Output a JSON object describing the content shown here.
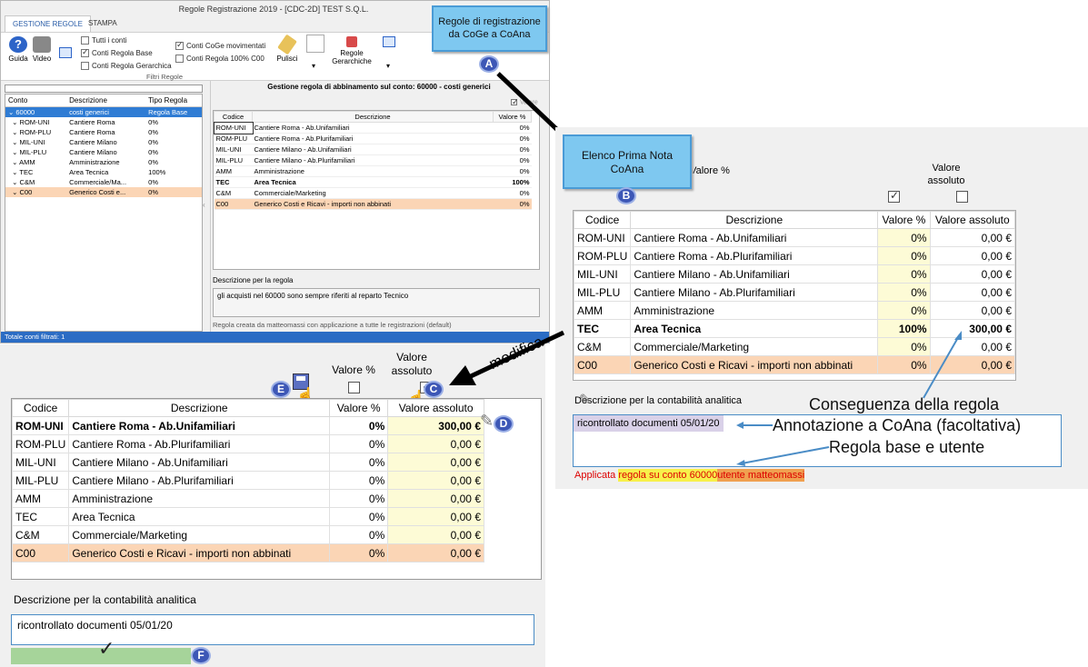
{
  "window": {
    "title": "Regole Registrazione 2019 - [CDC-2D] TEST S.Q.L.",
    "tabs": [
      "GESTIONE REGOLE",
      "STAMPA"
    ],
    "ribbon": {
      "guida": "Guida",
      "video": "Video",
      "filters": {
        "tutti_conti": "Tutti i conti",
        "conti_regola_base": "Conti Regola Base",
        "conti_regola_gerarchica": "Conti Regola Gerarchica",
        "conti_coge_movimentati": "Conti CoGe movimentati",
        "conti_regola_100": "Conti Regola 100% C00",
        "group_label": "Filtri Regole"
      },
      "pulisci": "Pulisci",
      "regole_gerarchiche": "Regole Gerarchiche"
    },
    "tree": {
      "columns": [
        "Conto",
        "Descrizione",
        "Tipo Regola"
      ],
      "rows": [
        {
          "conto": "60000",
          "desc": "costi generici",
          "tipo": "Regola Base"
        },
        {
          "conto": "ROM-UNI",
          "desc": "Cantiere Roma",
          "tipo": "0%"
        },
        {
          "conto": "ROM-PLU",
          "desc": "Cantiere Roma",
          "tipo": "0%"
        },
        {
          "conto": "MIL-UNI",
          "desc": "Cantiere Milano",
          "tipo": "0%"
        },
        {
          "conto": "MIL-PLU",
          "desc": "Cantiere Milano",
          "tipo": "0%"
        },
        {
          "conto": "AMM",
          "desc": "Amministrazione",
          "tipo": "0%"
        },
        {
          "conto": "TEC",
          "desc": "Area Tecnica",
          "tipo": "100%"
        },
        {
          "conto": "C&M",
          "desc": "Commerciale/Ma...",
          "tipo": "0%"
        },
        {
          "conto": "C00",
          "desc": "Generico Costi e...",
          "tipo": "0%"
        }
      ]
    },
    "status": "Totale conti filtrati: 1",
    "panel": {
      "header": "Gestione regola di abbinamento sul conto: 60000 - costi generici",
      "valore_chk": "Valore",
      "columns": [
        "Codice",
        "Descrizione",
        "Valore %"
      ],
      "rows": [
        {
          "code": "ROM-UNI",
          "desc": "Cantiere Roma - Ab.Unifamiliari",
          "pct": "0%"
        },
        {
          "code": "ROM-PLU",
          "desc": "Cantiere Roma - Ab.Plurifamiliari",
          "pct": "0%"
        },
        {
          "code": "MIL-UNI",
          "desc": "Cantiere Milano - Ab.Unifamiliari",
          "pct": "0%"
        },
        {
          "code": "MIL-PLU",
          "desc": "Cantiere Milano - Ab.Plurifamiliari",
          "pct": "0%"
        },
        {
          "code": "AMM",
          "desc": "Amministrazione",
          "pct": "0%"
        },
        {
          "code": "TEC",
          "desc": "Area Tecnica",
          "pct": "100%"
        },
        {
          "code": "C&M",
          "desc": "Commerciale/Marketing",
          "pct": "0%"
        },
        {
          "code": "C00",
          "desc": "Generico Costi e Ricavi - importi non abbinati",
          "pct": "0%"
        }
      ],
      "desc_label": "Descrizione per la regola",
      "desc_text": "gli acquisti nel 60000 sono sempre riferiti al reparto Tecnico",
      "footer": "Regola creata da matteomassi con applicazione a tutte le registrazioni (default)"
    }
  },
  "callout_a": {
    "text": "Regole di registrazione da CoGe a CoAna",
    "badge": "A"
  },
  "callout_b": {
    "text": "Elenco Prima Nota CoAna",
    "badge": "B"
  },
  "right": {
    "valore_pct": "Valore %",
    "valore_assoluto": "Valore assoluto",
    "columns": [
      "Codice",
      "Descrizione",
      "Valore %",
      "Valore assoluto"
    ],
    "rows": [
      {
        "code": "ROM-UNI",
        "desc": "Cantiere Roma - Ab.Unifamiliari",
        "pct": "0%",
        "abs": "0,00 €"
      },
      {
        "code": "ROM-PLU",
        "desc": "Cantiere Roma - Ab.Plurifamiliari",
        "pct": "0%",
        "abs": "0,00 €"
      },
      {
        "code": "MIL-UNI",
        "desc": "Cantiere Milano - Ab.Unifamiliari",
        "pct": "0%",
        "abs": "0,00 €"
      },
      {
        "code": "MIL-PLU",
        "desc": "Cantiere Milano - Ab.Plurifamiliari",
        "pct": "0%",
        "abs": "0,00 €"
      },
      {
        "code": "AMM",
        "desc": "Amministrazione",
        "pct": "0%",
        "abs": "0,00 €"
      },
      {
        "code": "TEC",
        "desc": "Area Tecnica",
        "pct": "100%",
        "abs": "300,00 €"
      },
      {
        "code": "C&M",
        "desc": "Commerciale/Marketing",
        "pct": "0%",
        "abs": "0,00 €"
      },
      {
        "code": "C00",
        "desc": "Generico Costi e Ricavi - importi non abbinati",
        "pct": "0%",
        "abs": "0,00 €"
      }
    ],
    "desc_label": "Descrizione per la contabilità analitica",
    "desc_value": "ricontrollato documenti 05/01/20",
    "applied": {
      "p1": "Applicata",
      "p2": "regola su conto 60000",
      "p3": "utente matteomassi"
    },
    "annotations": {
      "conseguenza": "Conseguenza della regola",
      "annotazione": "Annotazione a CoAna (facoltativa)",
      "regola": "Regola base e utente"
    }
  },
  "bottom": {
    "valore_pct": "Valore %",
    "valore_assoluto": "Valore assoluto",
    "modifica": "modifica",
    "columns": [
      "Codice",
      "Descrizione",
      "Valore %",
      "Valore assoluto"
    ],
    "rows": [
      {
        "code": "ROM-UNI",
        "desc": "Cantiere Roma - Ab.Unifamiliari",
        "pct": "0%",
        "abs": "300,00 €"
      },
      {
        "code": "ROM-PLU",
        "desc": "Cantiere Roma - Ab.Plurifamiliari",
        "pct": "0%",
        "abs": "0,00 €"
      },
      {
        "code": "MIL-UNI",
        "desc": "Cantiere Milano - Ab.Unifamiliari",
        "pct": "0%",
        "abs": "0,00 €"
      },
      {
        "code": "MIL-PLU",
        "desc": "Cantiere Milano - Ab.Plurifamiliari",
        "pct": "0%",
        "abs": "0,00 €"
      },
      {
        "code": "AMM",
        "desc": "Amministrazione",
        "pct": "0%",
        "abs": "0,00 €"
      },
      {
        "code": "TEC",
        "desc": "Area Tecnica",
        "pct": "0%",
        "abs": "0,00 €"
      },
      {
        "code": "C&M",
        "desc": "Commerciale/Marketing",
        "pct": "0%",
        "abs": "0,00 €"
      },
      {
        "code": "C00",
        "desc": "Generico Costi e Ricavi - importi non abbinati",
        "pct": "0%",
        "abs": "0,00 €"
      }
    ],
    "desc_label": "Descrizione per la contabilità analitica",
    "desc_value": "ricontrollato documenti 05/01/20",
    "badges": {
      "c": "C",
      "d": "D",
      "e": "E",
      "f": "F"
    }
  },
  "colors": {
    "accent_blue": "#7ec8f0",
    "badge": "#3d57b6",
    "peach": "#fbd5b5",
    "yellow": "#fdfbd6",
    "selection": "#2f7cd4"
  }
}
